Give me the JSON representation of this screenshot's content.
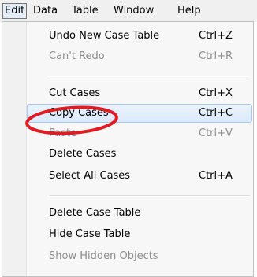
{
  "menubar": {
    "items": [
      {
        "label": "Edit"
      },
      {
        "label": "Data"
      },
      {
        "label": "Table"
      },
      {
        "label": "Window"
      },
      {
        "label": "Help"
      }
    ]
  },
  "edit_menu": {
    "items": [
      {
        "label": "Undo New Case Table",
        "shortcut": "Ctrl+Z",
        "enabled": true
      },
      {
        "label": "Can't Redo",
        "shortcut": "Ctrl+R",
        "enabled": false
      },
      {
        "label": "Cut Cases",
        "shortcut": "Ctrl+X",
        "enabled": true
      },
      {
        "label": "Copy Cases",
        "shortcut": "Ctrl+C",
        "enabled": true,
        "highlighted": true
      },
      {
        "label": "Paste",
        "shortcut": "Ctrl+V",
        "enabled": false
      },
      {
        "label": "Delete Cases",
        "shortcut": "",
        "enabled": true
      },
      {
        "label": "Select All Cases",
        "shortcut": "Ctrl+A",
        "enabled": true
      },
      {
        "label": "Delete Case Table",
        "shortcut": "",
        "enabled": true
      },
      {
        "label": "Hide Case Table",
        "shortcut": "",
        "enabled": true
      },
      {
        "label": "Show Hidden Objects",
        "shortcut": "",
        "enabled": false
      }
    ]
  },
  "colors": {
    "annotation": "#e01b24",
    "highlight_border": "#aac8ee",
    "disabled_text": "#8d8d8d"
  }
}
